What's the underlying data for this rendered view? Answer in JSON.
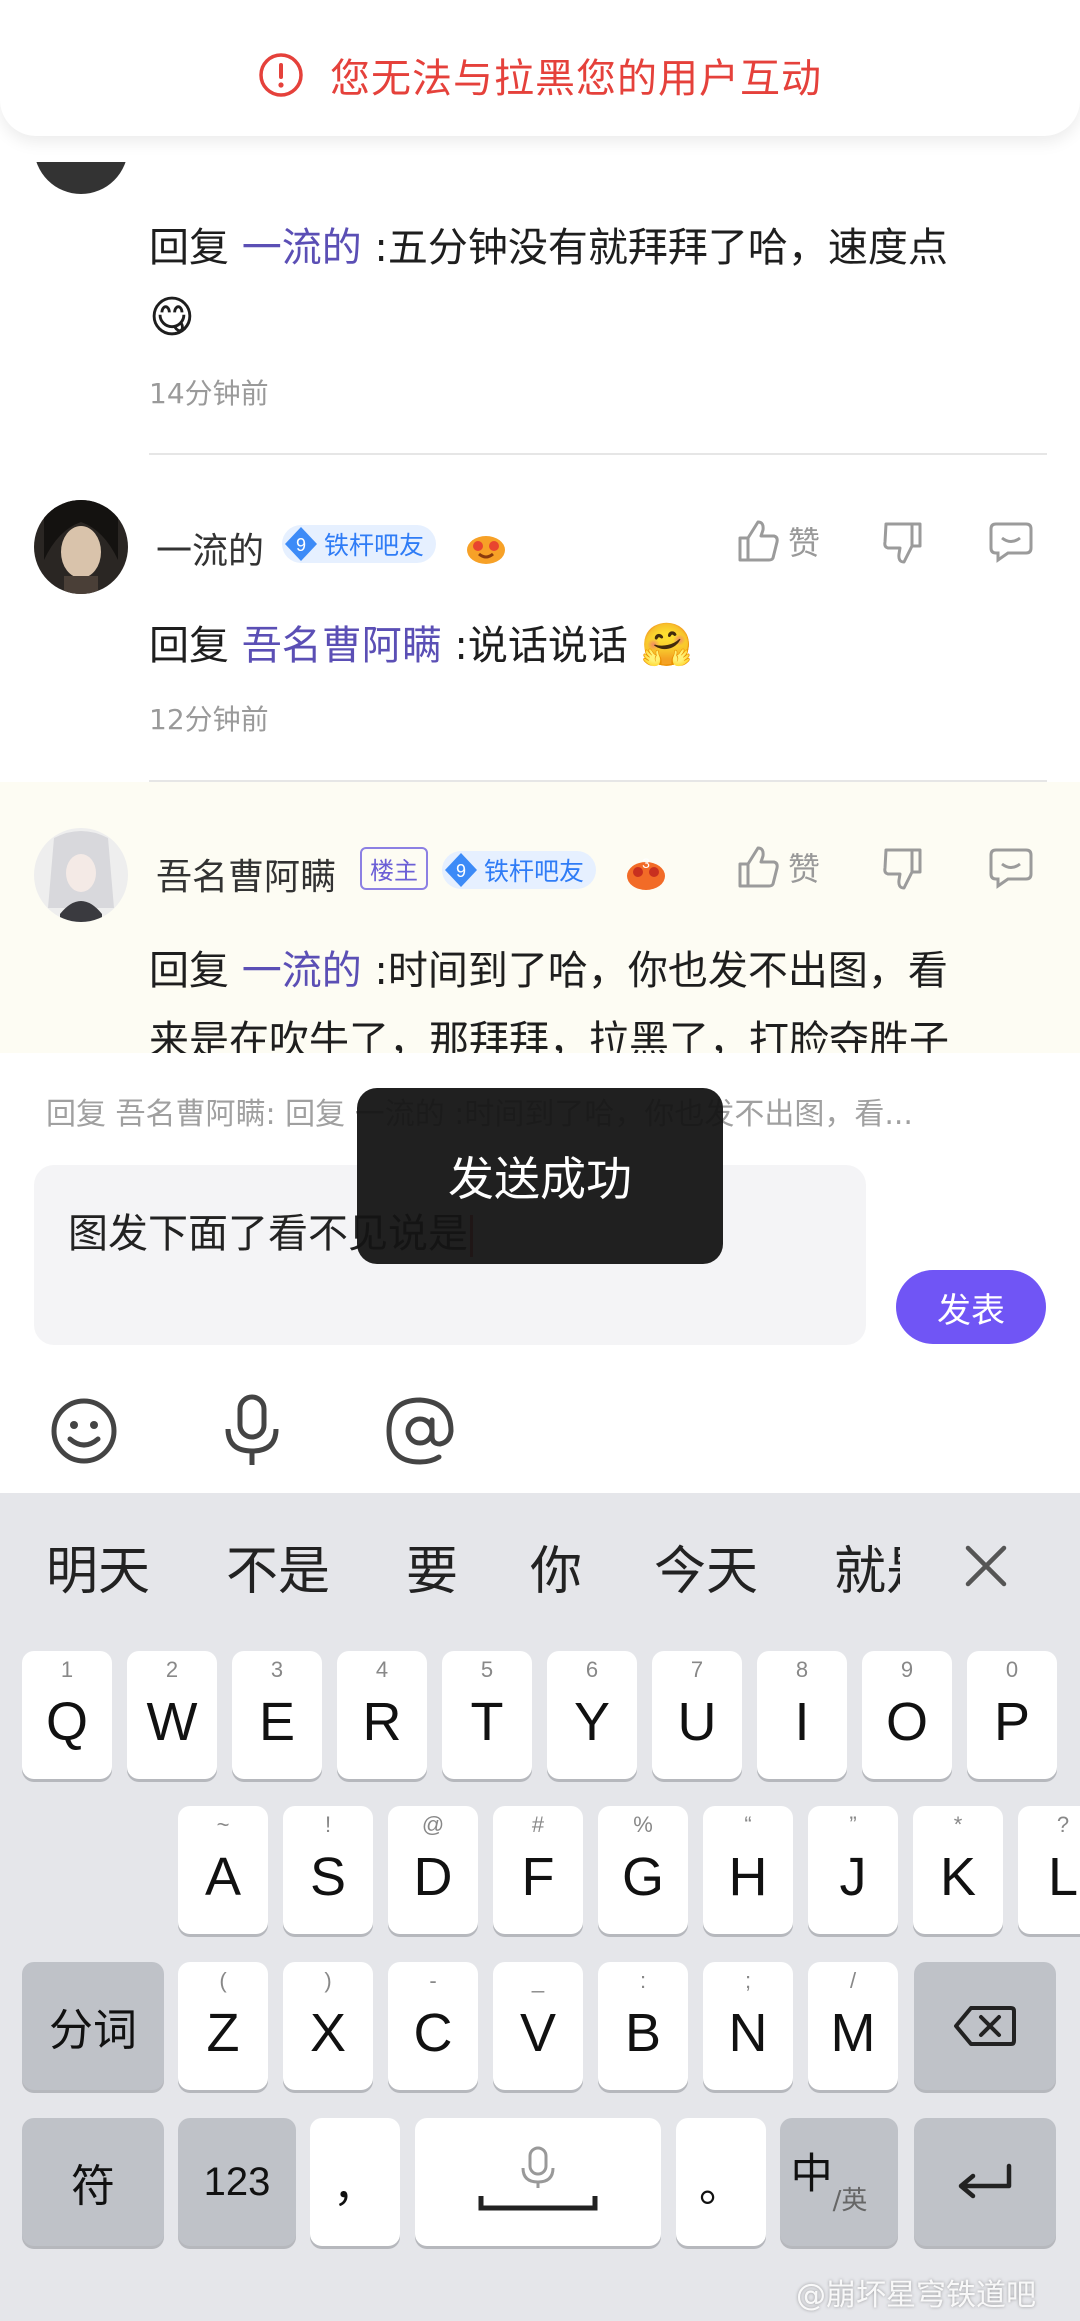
{
  "alert": {
    "text": "您无法与拉黑您的用户互动"
  },
  "comments": [
    {
      "text_prefix": "回复 ",
      "mention": "一流的",
      "text_body": " :五分钟没有就拜拜了哈，速度点",
      "emoji": "😋",
      "time": "14分钟前"
    },
    {
      "username": "一流的",
      "level": "9",
      "level_title": "铁杆吧友",
      "like_label": "赞",
      "text_prefix": "回复 ",
      "mention": "吾名曹阿瞒",
      "text_body": " :说话说话",
      "emoji": "🤗",
      "time": "12分钟前"
    },
    {
      "username": "吾名曹阿瞒",
      "host_badge": "楼主",
      "level": "9",
      "level_title": "铁杆吧友",
      "fire_level": "3",
      "like_label": "赞",
      "text_prefix": "回复 ",
      "mention": "一流的",
      "text_body": " :时间到了哈，你也发不出图，看",
      "text_line2": "来是在吹牛了，那拜拜，拉黑了，打脸夺胜子"
    }
  ],
  "composer": {
    "reply_hint": "回复 吾名曹阿瞒: 回复 一流的 :时间到了哈，你也发不出图，看...",
    "input_value": "图发下面了看不见说是",
    "send_label": "发表"
  },
  "toast": {
    "text": "发送成功"
  },
  "keyboard": {
    "candidates": [
      "明天",
      "不是",
      "要",
      "你",
      "今天",
      "就是"
    ],
    "row1": [
      {
        "k": "Q",
        "s": "1"
      },
      {
        "k": "W",
        "s": "2"
      },
      {
        "k": "E",
        "s": "3"
      },
      {
        "k": "R",
        "s": "4"
      },
      {
        "k": "T",
        "s": "5"
      },
      {
        "k": "Y",
        "s": "6"
      },
      {
        "k": "U",
        "s": "7"
      },
      {
        "k": "I",
        "s": "8"
      },
      {
        "k": "O",
        "s": "9"
      },
      {
        "k": "P",
        "s": "0"
      }
    ],
    "row2": [
      {
        "k": "A",
        "s": "~"
      },
      {
        "k": "S",
        "s": "!"
      },
      {
        "k": "D",
        "s": "@"
      },
      {
        "k": "F",
        "s": "#"
      },
      {
        "k": "G",
        "s": "%"
      },
      {
        "k": "H",
        "s": "“"
      },
      {
        "k": "J",
        "s": "”"
      },
      {
        "k": "K",
        "s": "*"
      },
      {
        "k": "L",
        "s": "?"
      }
    ],
    "row3": [
      {
        "k": "Z",
        "s": "("
      },
      {
        "k": "X",
        "s": ")"
      },
      {
        "k": "C",
        "s": "-"
      },
      {
        "k": "V",
        "s": "_"
      },
      {
        "k": "B",
        "s": ":"
      },
      {
        "k": "N",
        "s": ";"
      },
      {
        "k": "M",
        "s": "/"
      }
    ],
    "segment_label": "分词",
    "symbol_label": "符",
    "number_label": "123",
    "comma": "，",
    "period": "。",
    "lang_main": "中",
    "lang_sub": "/英"
  },
  "watermark": "@崩坏星穹铁道吧",
  "colors": {
    "accent": "#7055f5",
    "mention": "#5b4fb5",
    "alert": "#e5413b",
    "level_badge": "#2f7cf6"
  }
}
